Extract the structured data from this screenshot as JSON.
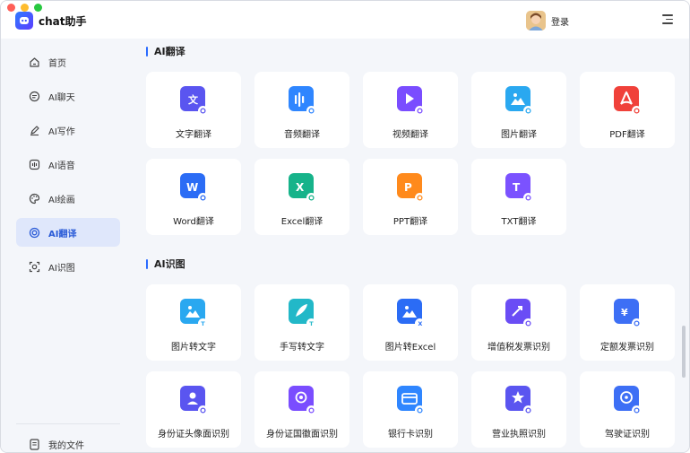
{
  "app": {
    "title": "chat助手"
  },
  "header": {
    "login_label": "登录"
  },
  "sidebar": {
    "items": [
      {
        "label": "首页",
        "icon": "home-icon"
      },
      {
        "label": "AI聊天",
        "icon": "chat-icon"
      },
      {
        "label": "AI写作",
        "icon": "pen-icon"
      },
      {
        "label": "AI语音",
        "icon": "voice-icon"
      },
      {
        "label": "AI绘画",
        "icon": "palette-icon"
      },
      {
        "label": "AI翻译",
        "icon": "translate-icon",
        "active": true
      },
      {
        "label": "AI识图",
        "icon": "scan-icon"
      }
    ],
    "files_label": "我的文件"
  },
  "translate": {
    "title": "AI翻译",
    "cards": [
      {
        "label": "文字翻译",
        "icon": "text-doc-icon",
        "color": "#5a55f0"
      },
      {
        "label": "音频翻译",
        "icon": "audio-icon",
        "color": "#2f86ff"
      },
      {
        "label": "视频翻译",
        "icon": "video-icon",
        "color": "#7a4dff"
      },
      {
        "label": "图片翻译",
        "icon": "image-icon",
        "color": "#2aa8f0"
      },
      {
        "label": "PDF翻译",
        "icon": "pdf-icon",
        "color": "#f0413a"
      },
      {
        "label": "Word翻译",
        "icon": "word-icon",
        "color": "#2b6cf5"
      },
      {
        "label": "Excel翻译",
        "icon": "excel-icon",
        "color": "#16b38a"
      },
      {
        "label": "PPT翻译",
        "icon": "ppt-icon",
        "color": "#ff8a1c"
      },
      {
        "label": "TXT翻译",
        "icon": "txt-icon",
        "color": "#7b52ff"
      }
    ]
  },
  "recognize": {
    "title": "AI识图",
    "cards": [
      {
        "label": "图片转文字",
        "icon": "image-to-text-icon",
        "color": "#2aa8f0"
      },
      {
        "label": "手写转文字",
        "icon": "handwriting-icon",
        "color": "#22b8c8"
      },
      {
        "label": "图片转Excel",
        "icon": "image-to-excel-icon",
        "color": "#2b6cf5"
      },
      {
        "label": "增值税发票识别",
        "icon": "vat-invoice-icon",
        "color": "#6a4df5"
      },
      {
        "label": "定额发票识别",
        "icon": "quota-invoice-icon",
        "color": "#3d6ff5"
      },
      {
        "label": "身份证头像面识别",
        "icon": "id-front-icon",
        "color": "#5a55f0"
      },
      {
        "label": "身份证国徽面识别",
        "icon": "id-back-icon",
        "color": "#7a4dff"
      },
      {
        "label": "银行卡识别",
        "icon": "bank-card-icon",
        "color": "#2f86ff"
      },
      {
        "label": "营业执照识别",
        "icon": "license-icon",
        "color": "#5a55f0"
      },
      {
        "label": "驾驶证识别",
        "icon": "driver-license-icon",
        "color": "#3d6ff5"
      }
    ]
  }
}
